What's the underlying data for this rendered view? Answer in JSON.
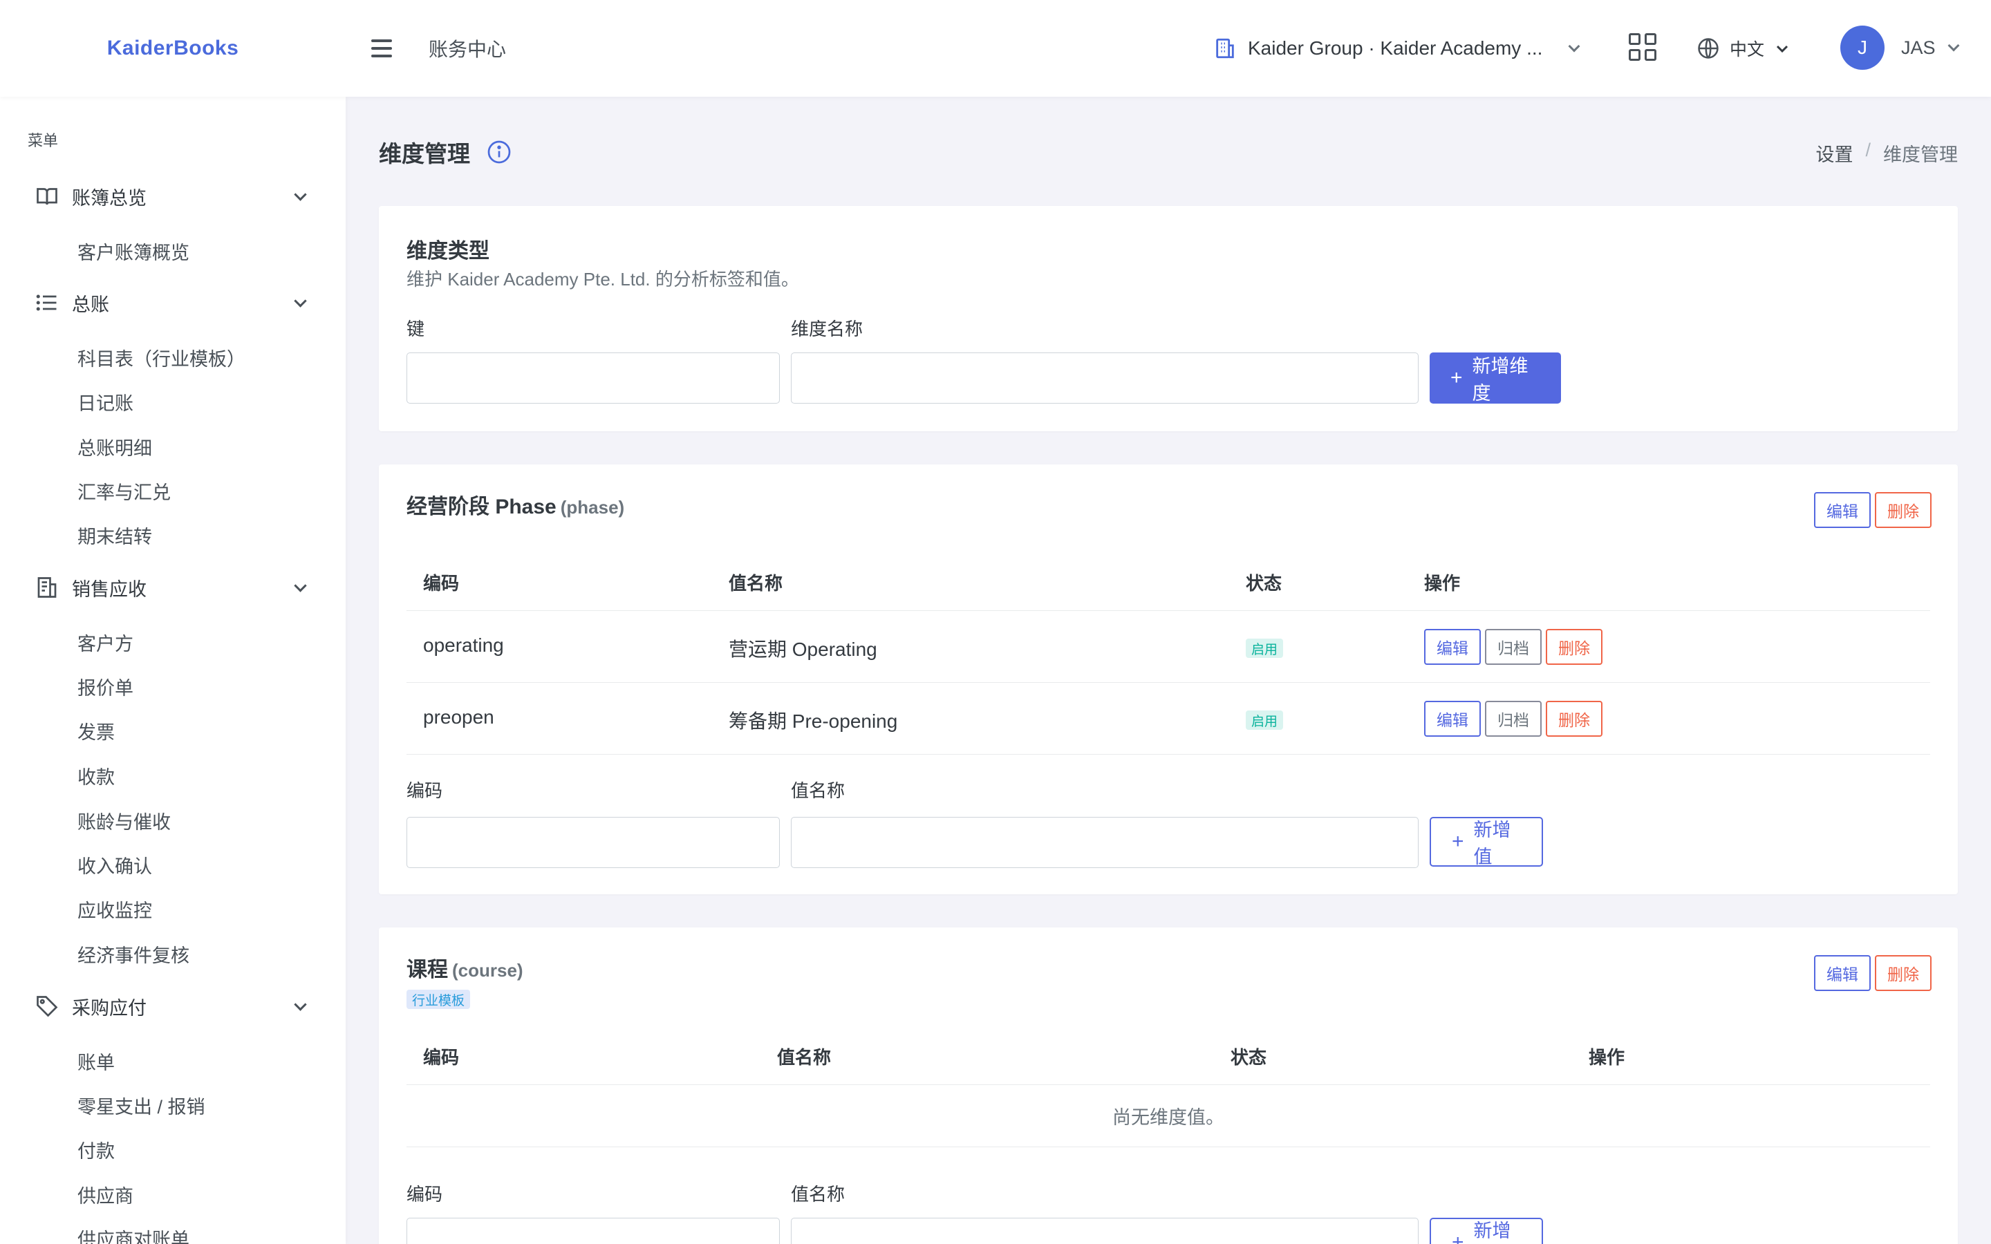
{
  "brand": "KaiderBooks",
  "topbar": {
    "title": "账务中心",
    "org": "Kaider Group · Kaider Academy ...",
    "language": "中文",
    "user_initial": "J",
    "user_name": "JAS"
  },
  "sidebar": {
    "menu_title": "菜单",
    "groups": [
      {
        "label": "账簿总览",
        "icon": "book-icon",
        "items": [
          "客户账簿概览"
        ]
      },
      {
        "label": "总账",
        "icon": "list-icon",
        "items": [
          "科目表（行业模板）",
          "日记账",
          "总账明细",
          "汇率与汇兑",
          "期末结转"
        ]
      },
      {
        "label": "销售应收",
        "icon": "invoice-icon",
        "items": [
          "客户方",
          "报价单",
          "发票",
          "收款",
          "账龄与催收",
          "收入确认",
          "应收监控",
          "经济事件复核"
        ]
      },
      {
        "label": "采购应付",
        "icon": "tag-icon",
        "items": [
          "账单",
          "零星支出 / 报销",
          "付款",
          "供应商",
          "供应商对账单"
        ]
      }
    ]
  },
  "page": {
    "title": "维度管理",
    "breadcrumb": [
      "设置",
      "维度管理"
    ]
  },
  "dimension_type_card": {
    "title": "维度类型",
    "subtitle": "维护 Kaider Academy Pte. Ltd. 的分析标签和值。",
    "key_label": "键",
    "name_label": "维度名称",
    "key_value": "",
    "name_value": "",
    "add_button": "新增维度"
  },
  "phase_card": {
    "title": "经营阶段 Phase",
    "key": "(phase)",
    "edit": "编辑",
    "delete": "删除",
    "columns": [
      "编码",
      "值名称",
      "状态",
      "操作"
    ],
    "rows": [
      {
        "code": "operating",
        "name": "营运期 Operating",
        "status": "启用",
        "edit": "编辑",
        "archive": "归档",
        "delete": "删除"
      },
      {
        "code": "preopen",
        "name": "筹备期 Pre-opening",
        "status": "启用",
        "edit": "编辑",
        "archive": "归档",
        "delete": "删除"
      }
    ],
    "code_label": "编码",
    "value_label": "值名称",
    "add_button": "新增值"
  },
  "course_card": {
    "title": "课程",
    "key": "(course)",
    "badge": "行业模板",
    "edit": "编辑",
    "delete": "删除",
    "columns": [
      "编码",
      "值名称",
      "状态",
      "操作"
    ],
    "empty": "尚无维度值。",
    "code_label": "编码",
    "value_label": "值名称",
    "add_button": "新增值"
  },
  "colors": {
    "primary": "#5468e0",
    "danger": "#f06548",
    "success": "#0ab39c",
    "brand": "#4b6bdc"
  }
}
